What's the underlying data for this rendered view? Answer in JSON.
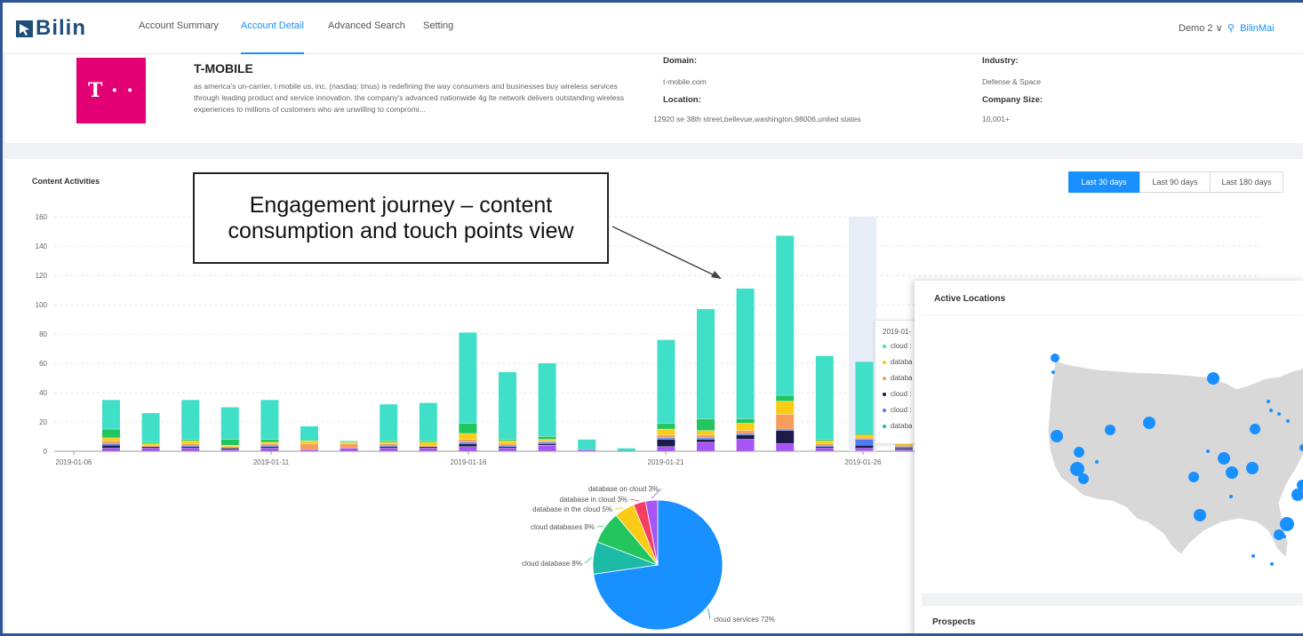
{
  "nav": {
    "brand": "Bilin",
    "items": [
      "Account Summary",
      "Account Detail",
      "Advanced Search",
      "Setting"
    ],
    "active": "Account Detail",
    "demo": "Demo 2 ∨",
    "user": "BilinMai"
  },
  "company": {
    "logo_text": "T · ·",
    "name": "T-MOBILE",
    "description": "as america's un-carrier, t-mobile us, inc. (nasdaq: tmus) is redefining the way consumers and businesses buy wireless services through leading product and service innovation. the company's advanced nationwide 4g lte network delivers outstanding wireless experiences to millions of customers who are unwilling to compromi...",
    "domain_label": "Domain:",
    "domain": "t-mobile.com",
    "location_label": "Location:",
    "location": "12920 se 38th street,bellevue,washington,98006,united states",
    "industry_label": "Industry:",
    "industry": "Defense & Space",
    "size_label": "Company Size:",
    "size": "10,001+"
  },
  "content": {
    "title": "Content Activities",
    "ranges": [
      "Last 30 days",
      "Last 90 days",
      "Last 180 days"
    ],
    "active_range": "Last 30 days"
  },
  "callout": "Engagement journey – content consumption and touch points view",
  "tooltip": {
    "date": "2019-01-",
    "rows": [
      "cloud :",
      "databa",
      "databa",
      "cloud :",
      "cloud :",
      "databa"
    ]
  },
  "locations": {
    "title": "Active Locations",
    "prospects_title": "Prospects"
  },
  "colors": {
    "cloud_services": "#40e0c8",
    "cloud_database": "#1ebaa8",
    "cloud_databases": "#22c55e",
    "database_in_the_cloud": "#facc15",
    "database_in_cloud": "#f59e5b",
    "database_on_cloud": "#a855f7",
    "navy": "#1e1b4b",
    "blue": "#4c7cf5",
    "pie_blue": "#1890ff",
    "accent": "#1890ff"
  },
  "chart_data": [
    {
      "type": "bar",
      "stacked": true,
      "ylim": [
        0,
        160
      ],
      "yticks": [
        0,
        20,
        40,
        60,
        80,
        100,
        120,
        140,
        160
      ],
      "x_tick_labels": [
        "2019-01-06",
        "2019-01-11",
        "2019-01-16",
        "2019-01-21",
        "2019-01-26"
      ],
      "categories": [
        "2019-01-06",
        "2019-01-07",
        "2019-01-08",
        "2019-01-09",
        "2019-01-10",
        "2019-01-11",
        "2019-01-12",
        "2019-01-13",
        "2019-01-14",
        "2019-01-15",
        "2019-01-16",
        "2019-01-17",
        "2019-01-18",
        "2019-01-19",
        "2019-01-20",
        "2019-01-21",
        "2019-01-22",
        "2019-01-23",
        "2019-01-24",
        "2019-01-25",
        "2019-01-26",
        "2019-01-27"
      ],
      "totals": [
        35,
        26,
        35,
        30,
        35,
        17,
        7,
        32,
        33,
        81,
        54,
        60,
        8,
        2,
        76,
        97,
        111,
        147,
        65,
        61,
        25,
        0
      ],
      "series": [
        {
          "name": "database on cloud",
          "color": "#a855f7",
          "values": [
            2,
            2,
            2,
            1,
            2,
            1,
            2,
            2,
            2,
            3,
            2,
            4,
            1,
            0,
            3,
            6,
            8,
            5,
            2,
            2,
            1,
            0
          ]
        },
        {
          "name": "cloud",
          "color": "#1e1b4b",
          "values": [
            2,
            1,
            1,
            1,
            1,
            0,
            0,
            1,
            1,
            2,
            1,
            1,
            0,
            0,
            5,
            2,
            3,
            9,
            1,
            2,
            1,
            0
          ]
        },
        {
          "name": "cloud",
          "color": "#4c7cf5",
          "values": [
            1,
            0,
            1,
            0,
            1,
            0,
            0,
            1,
            0,
            1,
            1,
            1,
            0,
            0,
            1,
            1,
            1,
            1,
            1,
            4,
            1,
            0
          ]
        },
        {
          "name": "database in cloud",
          "color": "#f59e5b",
          "values": [
            2,
            1,
            1,
            1,
            1,
            4,
            3,
            1,
            1,
            2,
            1,
            1,
            0,
            0,
            2,
            2,
            2,
            10,
            1,
            1,
            1,
            0
          ]
        },
        {
          "name": "database in the cloud",
          "color": "#facc15",
          "values": [
            2,
            1,
            2,
            1,
            1,
            2,
            1,
            1,
            2,
            4,
            2,
            1,
            0,
            0,
            4,
            3,
            5,
            9,
            2,
            2,
            1,
            0
          ]
        },
        {
          "name": "cloud databases",
          "color": "#22c55e",
          "values": [
            6,
            1,
            1,
            4,
            2,
            0,
            0,
            1,
            1,
            7,
            1,
            2,
            0,
            0,
            4,
            8,
            3,
            4,
            1,
            1,
            1,
            0
          ]
        },
        {
          "name": "cloud services",
          "color": "#40e0c8",
          "values": [
            20,
            20,
            27,
            22,
            27,
            10,
            1,
            25,
            26,
            62,
            46,
            50,
            7,
            2,
            57,
            75,
            89,
            109,
            57,
            49,
            19,
            0
          ]
        }
      ]
    },
    {
      "type": "pie",
      "slices": [
        {
          "label": "cloud services",
          "value": 72,
          "text": "cloud services 72%",
          "color": "#1890ff"
        },
        {
          "label": "cloud database",
          "value": 8,
          "text": "cloud database 8%",
          "color": "#1ebaa8"
        },
        {
          "label": "cloud databases",
          "value": 8,
          "text": "cloud databases 8%",
          "color": "#22c55e"
        },
        {
          "label": "database in the cloud",
          "value": 5,
          "text": "database in the cloud 5%",
          "color": "#facc15"
        },
        {
          "label": "database in cloud",
          "value": 3,
          "text": "database in cloud 3%",
          "color": "#f43f5e"
        },
        {
          "label": "database on cloud",
          "value": 3,
          "text": "database on cloud 3%",
          "color": "#a855f7"
        }
      ]
    }
  ]
}
